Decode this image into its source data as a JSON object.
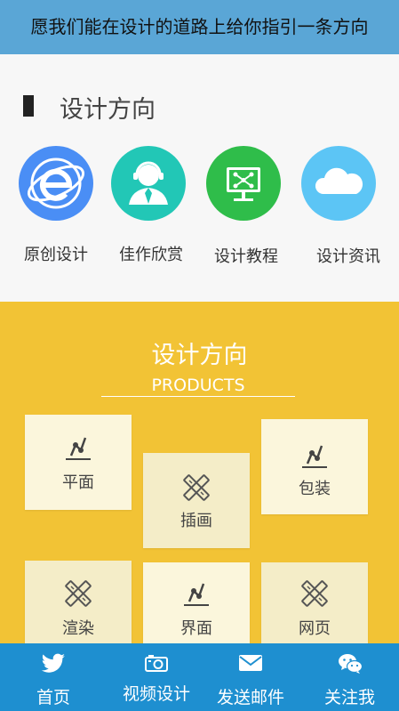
{
  "banner": {
    "text": "愿我们能在设计的道路上给你指引一条方向"
  },
  "section1": {
    "title": "设计方向",
    "items": [
      {
        "label": "原创设计",
        "icon": "ie-browser-icon",
        "color": "#4a8ef5"
      },
      {
        "label": "佳作欣赏",
        "icon": "support-agent-icon",
        "color": "#22c7b6"
      },
      {
        "label": "设计教程",
        "icon": "presentation-icon",
        "color": "#2fbd4a"
      },
      {
        "label": "设计资讯",
        "icon": "cloud-icon",
        "color": "#5cc5f5"
      }
    ]
  },
  "products": {
    "title": "设计方向",
    "subtitle": "PRODUCTS",
    "accent": "#f2c335",
    "cards": [
      {
        "label": "平面",
        "icon": "vector-pen-icon"
      },
      {
        "label": "插画",
        "icon": "pencil-ruler-icon"
      },
      {
        "label": "包装",
        "icon": "vector-pen-icon"
      },
      {
        "label": "渲染",
        "icon": "pencil-ruler-icon"
      },
      {
        "label": "界面",
        "icon": "vector-pen-icon"
      },
      {
        "label": "网页",
        "icon": "pencil-ruler-icon"
      }
    ]
  },
  "nav": {
    "color": "#1e8fd0",
    "items": [
      {
        "label": "首页",
        "icon": "twitter-bird-icon"
      },
      {
        "label": "视频设计",
        "icon": "camera-icon"
      },
      {
        "label": "发送邮件",
        "icon": "mail-icon"
      },
      {
        "label": "关注我",
        "icon": "wechat-icon"
      }
    ]
  }
}
